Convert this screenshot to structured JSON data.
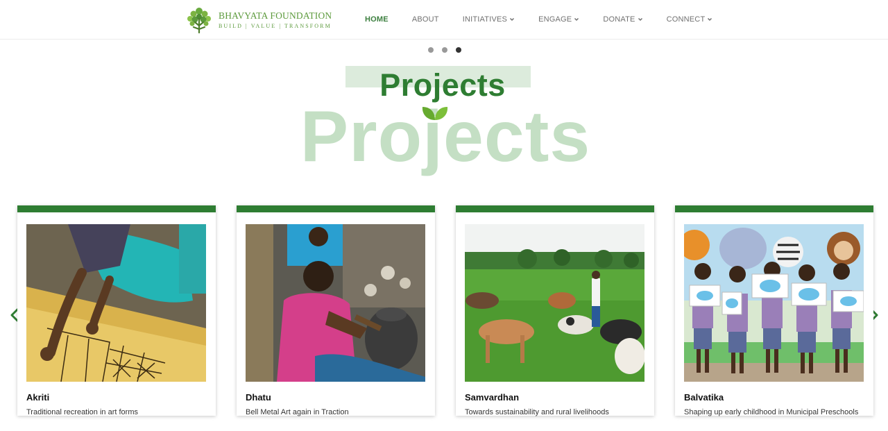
{
  "brand": {
    "name": "BHAVYATA FOUNDATION",
    "tagline": "BUILD | VALUE | TRANSFORM"
  },
  "nav": {
    "items": [
      {
        "label": "HOME",
        "active": true,
        "dropdown": false
      },
      {
        "label": "ABOUT",
        "active": false,
        "dropdown": false
      },
      {
        "label": "INITIATIVES",
        "active": false,
        "dropdown": true
      },
      {
        "label": "ENGAGE",
        "active": false,
        "dropdown": true
      },
      {
        "label": "DONATE",
        "active": false,
        "dropdown": true
      },
      {
        "label": "CONNECT",
        "active": false,
        "dropdown": true
      }
    ]
  },
  "slider": {
    "total": 3,
    "active_index": 3
  },
  "section": {
    "title": "Projects",
    "watermark": "Projects"
  },
  "projects": [
    {
      "title": "Akriti",
      "description": "Traditional recreation in art forms",
      "image_icon": "artisan-painting-photo"
    },
    {
      "title": "Dhatu",
      "description": "Bell Metal Art again in Traction",
      "image_icon": "metal-artisan-photo"
    },
    {
      "title": "Samvardhan",
      "description": "Towards sustainability and rural livelihoods",
      "image_icon": "cattle-field-photo"
    },
    {
      "title": "Balvatika",
      "description": "Shaping up early childhood in Municipal Preschools",
      "image_icon": "preschool-children-photo"
    }
  ],
  "colors": {
    "brand_green": "#2e7d32",
    "logo_green": "#5c9a3c",
    "watermark_green": "#c4dfc4"
  }
}
